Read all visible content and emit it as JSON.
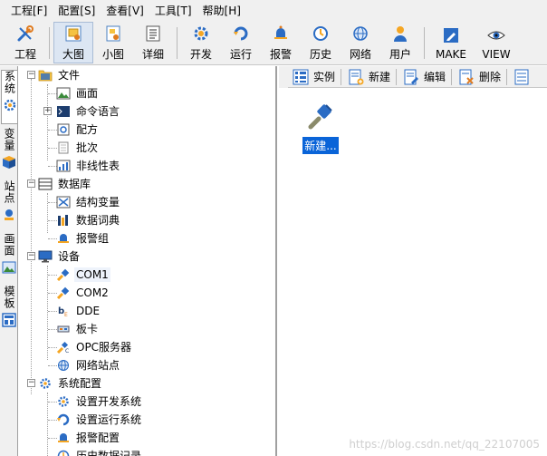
{
  "menu": [
    {
      "label": "工程[F]"
    },
    {
      "label": "配置[S]"
    },
    {
      "label": "查看[V]"
    },
    {
      "label": "工具[T]"
    },
    {
      "label": "帮助[H]"
    }
  ],
  "toolbar": {
    "project": {
      "label": "工程",
      "icon": "wrench-icon"
    },
    "large": {
      "label": "大图",
      "icon": "large-icons-icon",
      "pressed": true
    },
    "small": {
      "label": "小图",
      "icon": "small-icons-icon"
    },
    "detail": {
      "label": "详细",
      "icon": "details-icon"
    },
    "develop": {
      "label": "开发",
      "icon": "gear-icon"
    },
    "run": {
      "label": "运行",
      "icon": "run-icon"
    },
    "alarm": {
      "label": "报警",
      "icon": "bell-icon"
    },
    "history": {
      "label": "历史",
      "icon": "clock-icon"
    },
    "network": {
      "label": "网络",
      "icon": "globe-icon"
    },
    "user": {
      "label": "用户",
      "icon": "user-icon"
    },
    "make": {
      "label": "MAKE",
      "icon": "pencil-icon"
    },
    "view": {
      "label": "VIEW",
      "icon": "eye-icon"
    }
  },
  "vtabs": [
    {
      "label": "系统",
      "icon": "gear-icon",
      "active": true
    },
    {
      "label": "变量",
      "icon": "cube-icon"
    },
    {
      "label": "站点",
      "icon": "station-icon"
    },
    {
      "label": "画面",
      "icon": "picture-icon"
    },
    {
      "label": "模板",
      "icon": "template-icon"
    }
  ],
  "tree": {
    "file": {
      "label": "文件",
      "items": [
        "画面",
        "命令语言",
        "配方",
        "批次",
        "非线性表"
      ]
    },
    "database": {
      "label": "数据库",
      "items": [
        "结构变量",
        "数据词典",
        "报警组"
      ]
    },
    "device": {
      "label": "设备",
      "items": [
        "COM1",
        "COM2",
        "DDE",
        "板卡",
        "OPC服务器",
        "网络站点"
      ]
    },
    "sysconfig": {
      "label": "系统配置",
      "items": [
        "设置开发系统",
        "设置运行系统",
        "报警配置",
        "历史数据记录"
      ]
    }
  },
  "right_toolbar": {
    "instance": "实例",
    "new": "新建",
    "edit": "编辑",
    "delete": "删除"
  },
  "content": {
    "new_item": "新建..."
  },
  "watermark": "https://blog.csdn.net/qq_22107005",
  "colors": {
    "accent": "#0a64d8",
    "folder": "#f5c242",
    "blue": "#2b6cc4"
  }
}
